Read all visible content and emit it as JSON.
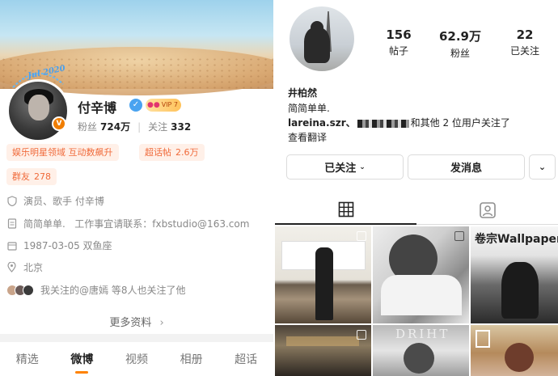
{
  "weibo": {
    "deco_text": "Jul 2020",
    "name": "付辛博",
    "vip_badge": "VIP 7",
    "followers_label": "粉丝",
    "followers_value": "724万",
    "following_label": "关注",
    "following_value": "332",
    "tags": {
      "star_tag": "娱乐明星领域 互动数飙升",
      "super_topic_label": "超话帖",
      "super_topic_value": "2.6万",
      "group_label": "群友",
      "group_value": "278"
    },
    "info": {
      "role": "演员、歌手 付辛博",
      "bio": "简简单单.   工作事宜请联系：fxbstudio@163.com",
      "birthday": "1987-03-05 双鱼座",
      "location": "北京",
      "mutual": "我关注的@唐嫣  等8人也关注了他"
    },
    "more_label": "更多资料",
    "tabs": [
      "精选",
      "微博",
      "视频",
      "相册",
      "超话"
    ],
    "active_tab": "微博",
    "accent_color": "#ff8200"
  },
  "instagram": {
    "posts_value": "156",
    "posts_label": "帖子",
    "followers_value": "62.9万",
    "followers_label": "粉丝",
    "following_value": "22",
    "following_label": "已关注",
    "name": "井柏然",
    "bio": "简简单单.",
    "followed_by_user": "lareina.szr、",
    "followed_by_rest": "和其他 2 位用户关注了",
    "translate_label": "查看翻译",
    "following_button": "已关注",
    "message_button": "发消息",
    "grid_titles": {
      "cell3": "卷宗Wallpaper",
      "cell5": "DRIHT"
    }
  }
}
